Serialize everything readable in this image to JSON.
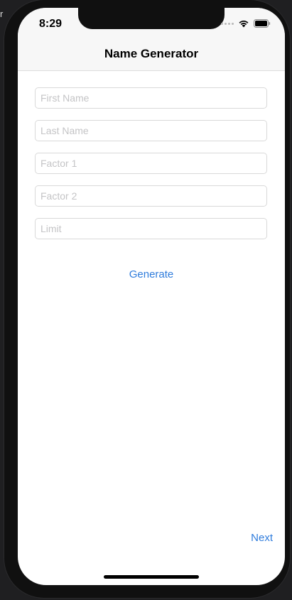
{
  "status_bar": {
    "time": "8:29"
  },
  "nav": {
    "title": "Name Generator"
  },
  "form": {
    "fields": [
      {
        "placeholder": "First Name",
        "value": ""
      },
      {
        "placeholder": "Last Name",
        "value": ""
      },
      {
        "placeholder": "Factor 1",
        "value": ""
      },
      {
        "placeholder": "Factor 2",
        "value": ""
      },
      {
        "placeholder": "Limit",
        "value": ""
      }
    ]
  },
  "actions": {
    "generate_label": "Generate",
    "next_label": "Next"
  },
  "backdrop": {
    "edge_text": "r"
  },
  "colors": {
    "accent": "#2f7cdc",
    "nav_background": "#f7f7f7",
    "placeholder": "#c4c4c6",
    "frame": "#101010"
  },
  "icons": [
    "signal-dots-icon",
    "wifi-icon",
    "battery-icon"
  ]
}
